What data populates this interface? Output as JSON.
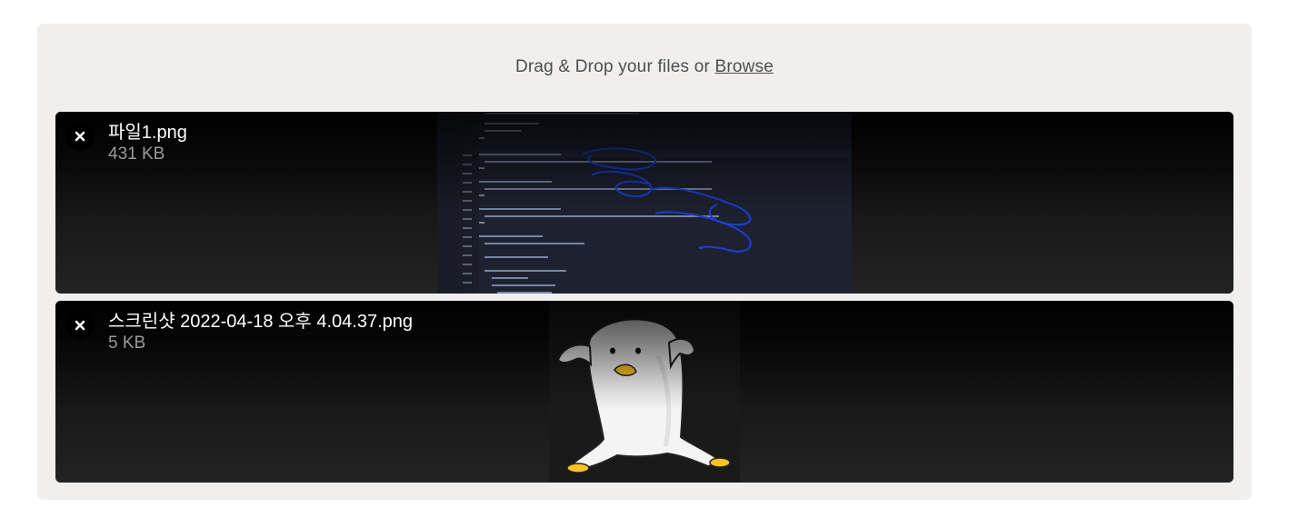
{
  "dropzone": {
    "label_prefix": "Drag & Drop your files or ",
    "browse_label": "Browse"
  },
  "files": [
    {
      "name": "파일1.png",
      "size": "431 KB",
      "thumbnail": "code-editor-screenshot"
    },
    {
      "name": "스크린샷 2022-04-18 오후 4.04.37.png",
      "size": "5 KB",
      "thumbnail": "penguin-sticker"
    }
  ],
  "colors": {
    "dropzone_bg": "#f0efed",
    "item_bg": "#151515",
    "scribble": "#1d3fd6"
  }
}
